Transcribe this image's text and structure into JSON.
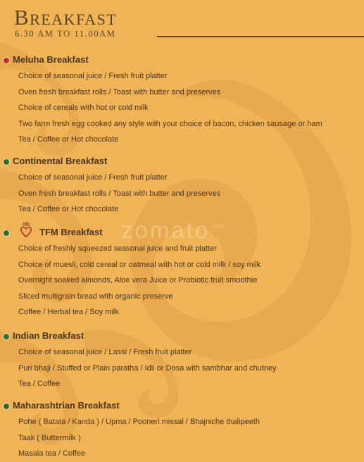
{
  "header": {
    "title": "Breakfast",
    "hours": "6.30 AM TO 11.00AM"
  },
  "watermark": {
    "text": "zomato",
    "suffix": ".com"
  },
  "sections": [
    {
      "name": "Meluha Breakfast",
      "marker_color": "#c4302b",
      "items": [
        "Choice of seasonal juice / Fresh fruit platter",
        "Oven fresh breakfast rolls / Toast with butter and preserves",
        "Choice of cereals with hot or cold milk",
        "Two farm fresh egg cooked any style with your choice of bacon, chicken sausage or ham",
        "Tea / Coffee or Hot chocolate"
      ]
    },
    {
      "name": "Continental Breakfast",
      "marker_color": "#2e6b32",
      "items": [
        "Choice of seasonal juice / Fresh fruit platter",
        "Oven fresh breakfast rolls / Toast with butter and preserves",
        "Tea / Coffee or Hot chocolate"
      ]
    },
    {
      "name": "TFM Breakfast",
      "marker_color": "#2e6b32",
      "marker_icon": "heart-crown-logo-icon",
      "items": [
        "Choice of freshly squeezed seasonal juice and fruit platter",
        "Choice of muesli, cold cereal or oatmeal with hot or cold milk / soy milk",
        "Overnight soaked almonds, Aloe vera Juice or Probiotic fruit smoothie",
        "Sliced multigrain bread with organic preserve",
        "Coffee / Herbal tea / Soy milk"
      ]
    },
    {
      "name": "Indian Breakfast",
      "marker_color": "#2e6b32",
      "items": [
        "Choice of seasonal juice / Lassi / Fresh fruit platter",
        "Puri bhaji / Stuffed or Plain paratha / Idli or Dosa with sambhar and chutney",
        "Tea / Coffee"
      ]
    },
    {
      "name": "Maharashtrian Breakfast",
      "marker_color": "#2e6b32",
      "items": [
        "Pohe ( Batata / Kanda ) / Upma / Pooneri missal / Bhajniche thalipeeth",
        "Taak ( Buttermilk )",
        "Masala tea / Coffee"
      ]
    }
  ]
}
